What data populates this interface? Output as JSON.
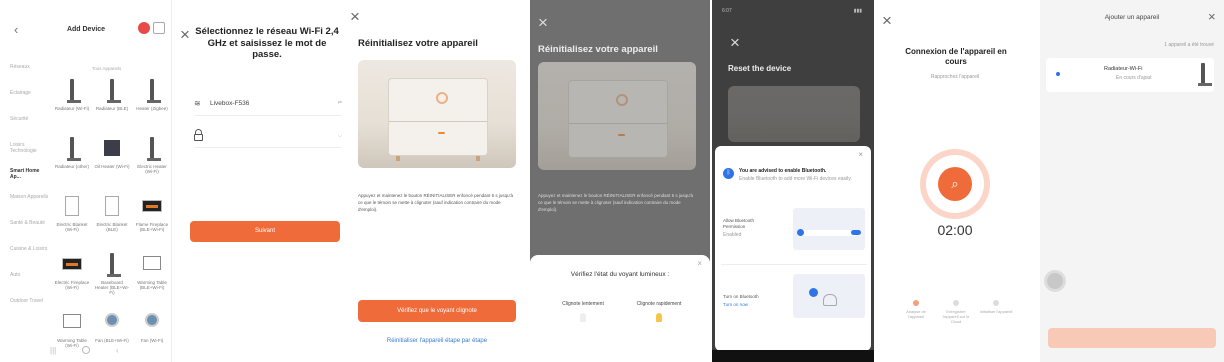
{
  "panel1": {
    "title": "Add Device",
    "tab_all": "Tous Appareils",
    "categories": [
      "Réseaux",
      "Éclairage",
      "Sécurité",
      "Loisirs Technologie",
      "Smart Home Ap...",
      "Maison Appareils",
      "Santé & Beauté",
      "Cuisine & Loisirs",
      "Auto",
      "Outdoor Travel"
    ],
    "devices": [
      {
        "label": "Radiateur (Wi-Fi)",
        "icon": "pole"
      },
      {
        "label": "Radiateur (BLE)",
        "icon": "pole"
      },
      {
        "label": "Heater (Zigbee)",
        "icon": "pole"
      },
      {
        "label": "Radiateur (other)",
        "icon": "pole"
      },
      {
        "label": "Oil Heater (Wi-Fi)",
        "icon": "dark"
      },
      {
        "label": "Electric Heater (Wi-Fi)",
        "icon": "pole"
      },
      {
        "label": "Electric Blanket (Wi-Fi)",
        "icon": "whitep"
      },
      {
        "label": "Electric Blanket (BLE)",
        "icon": "whitep"
      },
      {
        "label": "Flame Fireplace (BLE+Wi-Fi)",
        "icon": "fire"
      },
      {
        "label": "Electric Fireplace (Wi-Fi)",
        "icon": "fire"
      },
      {
        "label": "Baseboard Heater (BLE+Wi-Fi)",
        "icon": "pole"
      },
      {
        "label": "Warming Table (BLE+Wi-Fi)",
        "icon": "rect"
      },
      {
        "label": "Warming Table (Wi-Fi)",
        "icon": "rect"
      },
      {
        "label": "Fan (BLE+Wi-Fi)",
        "icon": "fan"
      },
      {
        "label": "Fan (Wi-Fi)",
        "icon": "fan"
      }
    ]
  },
  "panel2": {
    "title": "Sélectionnez le réseau Wi-Fi 2,4 GHz et saisissez le mot de passe.",
    "wifi_value": "Livebox-F536",
    "button": "Suivant"
  },
  "panel3": {
    "title": "Réinitialisez votre appareil",
    "body": "Appuyez et maintenez le bouton RÉINITIALISER enfoncé pendant 5 s jusqu'à ce que le témoin se mette à clignoter (sauf indication contraire du mode d'emploi).",
    "primary_button": "Vérifiez que le voyant clignote",
    "link": "Réinitialiser l'appareil étape par étape"
  },
  "panel4": {
    "title": "Réinitialisez votre appareil",
    "body": "Appuyez et maintenez le bouton RÉINITIALISER enfoncé pendant 5 s jusqu'à ce que le témoin se mette à clignoter (sauf indication contraire du mode d'emploi).",
    "sheet_title": "Vérifiez l'état du voyant lumineux :",
    "option1": "Clignote lentement",
    "option2": "Clignote rapidement"
  },
  "panel5": {
    "time": "6:07",
    "title": "Reset the device",
    "card_title": "You are advised to enable Bluetooth.",
    "card_sub": "Enable Bluetooth to add more Wi-Fi devices easily.",
    "allow_title": "Allow Bluetooth Permission",
    "allow_status": "Enabled",
    "turn_title": "Turn on Bluetooth",
    "turn_link": "Turn on now"
  },
  "panel6": {
    "title": "Connexion de l'appareil en cours",
    "subtitle": "Rapprochez l'appareil",
    "timer": "02:00",
    "steps": [
      "Analyse de l'appareil",
      "Enregistrer l'appareil sur le Cloud",
      "Initialiser l'appareil"
    ]
  },
  "panel7": {
    "title": "Ajouter un appareil",
    "subtitle": "1 appareil a été trouvé",
    "device_name": "Radiateur-Wi-Fi",
    "device_status": "En cours d'ajout"
  },
  "colors": {
    "accent": "#f06b3a",
    "link": "#3a7bd5",
    "bluetooth": "#2f74e6"
  }
}
